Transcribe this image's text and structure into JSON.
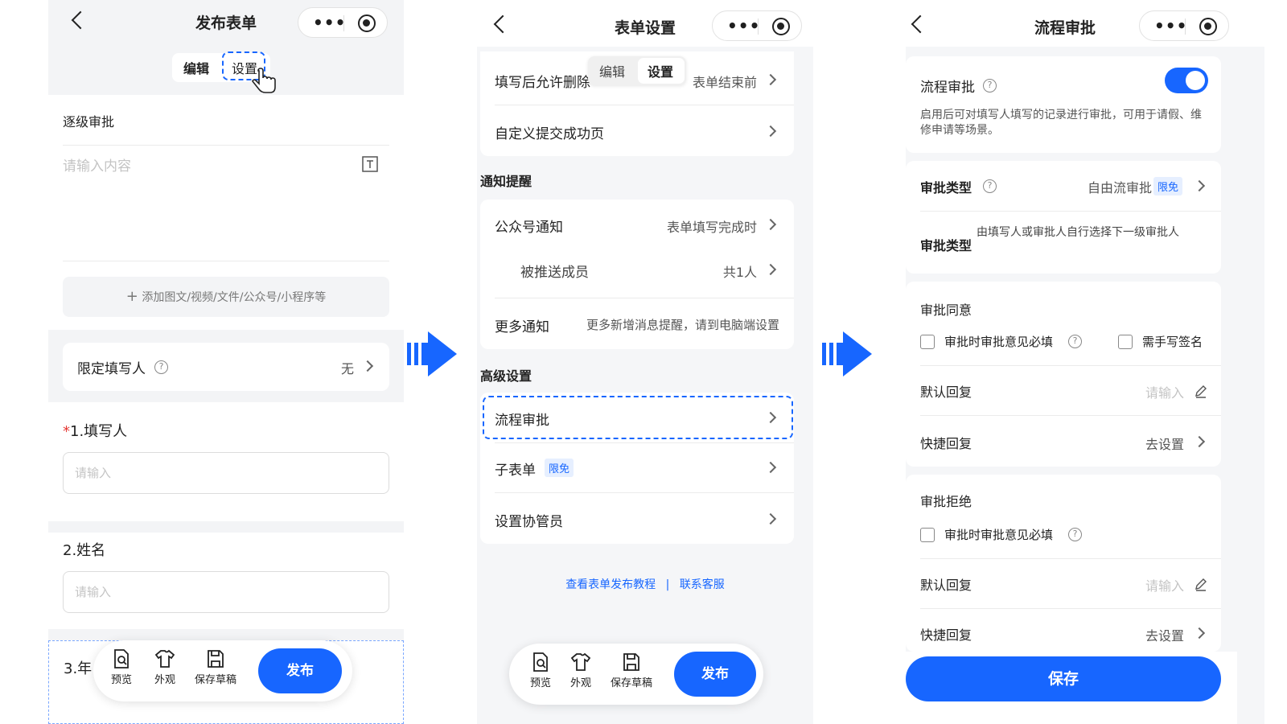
{
  "panel1": {
    "title": "发布表单",
    "tabs": [
      "编辑",
      "设置"
    ],
    "section_title": "逐级审批",
    "desc_placeholder": "请输入内容",
    "add_media": "添加图文/视频/文件/公众号/小程序等",
    "limit_label": "限定填写人",
    "limit_value": "无",
    "field1_required": "*",
    "field1_label": "1.填写人",
    "field1_placeholder": "请输入",
    "field2_label": "2.姓名",
    "field2_placeholder": "请输入",
    "field3_label": "3.年",
    "bottom": {
      "preview": "预览",
      "appearance": "外观",
      "save_draft": "保存草稿",
      "publish": "发布"
    }
  },
  "panel2": {
    "title": "表单设置",
    "tabs": [
      "编辑",
      "设置"
    ],
    "allow_delete_label": "填写后允许删除",
    "allow_delete_value": "表单结束前",
    "custom_success": "自定义提交成功页",
    "notify_section": "通知提醒",
    "mp_notify_label": "公众号通知",
    "mp_notify_value": "表单填写完成时",
    "push_members_label": "被推送成员",
    "push_members_value": "共1人",
    "more_notify_label": "更多通知",
    "more_notify_value": "更多新增消息提醒，请到电脑端设置",
    "advanced_section": "高级设置",
    "flow_approval": "流程审批",
    "sub_form": "子表单",
    "sub_form_badge": "限免",
    "co_admin": "设置协管员",
    "link_tutorial": "查看表单发布教程",
    "link_sep": "|",
    "link_support": "联系客服",
    "bottom": {
      "preview": "预览",
      "appearance": "外观",
      "save_draft": "保存草稿",
      "publish": "发布"
    }
  },
  "panel3": {
    "title": "流程审批",
    "flow_label": "流程审批",
    "flow_desc": "启用后可对填写人填写的记录进行审批，可用于请假、维修申请等场景。",
    "type_label": "审批类型",
    "type_value": "自由流审批",
    "type_badge": "限免",
    "type_label2": "审批类型",
    "type_desc": "由填写人或审批人自行选择下一级审批人",
    "agree_section": "审批同意",
    "agree_opinion": "审批时审批意见必填",
    "agree_sign": "需手写签名",
    "default_reply": "默认回复",
    "default_reply_ph": "请输入",
    "quick_reply": "快捷回复",
    "quick_reply_value": "去设置",
    "reject_section": "审批拒绝",
    "reject_opinion": "审批时审批意见必填",
    "default_reply2": "默认回复",
    "default_reply_ph2": "请输入",
    "quick_reply2": "快捷回复",
    "quick_reply_value2": "去设置",
    "save": "保存"
  },
  "colors": {
    "accent": "#1766ff",
    "background": "#f5f6f8"
  }
}
